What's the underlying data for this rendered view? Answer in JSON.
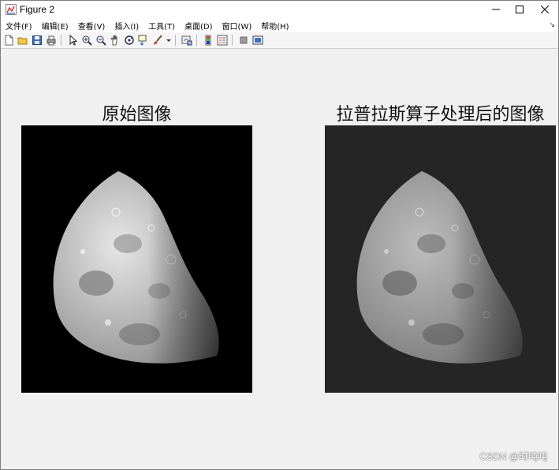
{
  "window": {
    "title": "Figure 2",
    "icon": "matlab-figure-icon"
  },
  "window_controls": [
    "minimize-icon",
    "maximize-icon",
    "close-icon"
  ],
  "menu": [
    {
      "label": "文件(F)"
    },
    {
      "label": "编辑(E)"
    },
    {
      "label": "查看(V)"
    },
    {
      "label": "插入(I)"
    },
    {
      "label": "工具(T)"
    },
    {
      "label": "桌面(D)"
    },
    {
      "label": "窗口(W)"
    },
    {
      "label": "帮助(H)"
    }
  ],
  "toolbar": [
    "new-figure-icon",
    "open-file-icon",
    "save-icon",
    "print-icon",
    "select-arrow-icon",
    "zoom-in-icon",
    "zoom-out-icon",
    "pan-icon",
    "rotate-icon",
    "data-cursor-icon",
    "brush-icon",
    "link-plot-icon",
    "colorbar-icon",
    "legend-icon",
    "hide-plot-tools-icon",
    "show-plot-tools-icon"
  ],
  "axes": [
    {
      "title": "原始图像",
      "background": "#000000",
      "moon_brightness": "bright"
    },
    {
      "title": "拉普拉斯算子处理后的图像",
      "background": "#252525",
      "moon_brightness": "dim"
    }
  ],
  "watermark": "CSDN @时吨吨"
}
